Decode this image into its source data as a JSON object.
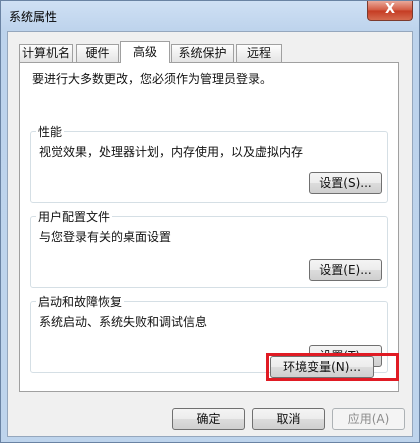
{
  "window": {
    "title": "系统属性",
    "close_label": "X"
  },
  "tabs": [
    {
      "label": "计算机名",
      "active": false
    },
    {
      "label": "硬件",
      "active": false
    },
    {
      "label": "高级",
      "active": true
    },
    {
      "label": "系统保护",
      "active": false
    },
    {
      "label": "远程",
      "active": false
    }
  ],
  "advanced": {
    "admin_note": "要进行大多数更改，您必须作为管理员登录。",
    "performance": {
      "title": "性能",
      "description": "视觉效果，处理器计划，内存使用，以及虚拟内存",
      "button": "设置(S)..."
    },
    "user_profiles": {
      "title": "用户配置文件",
      "description": "与您登录有关的桌面设置",
      "button": "设置(E)..."
    },
    "startup_recovery": {
      "title": "启动和故障恢复",
      "description": "系统启动、系统失败和调试信息",
      "button": "设置(T)..."
    },
    "env_button": "环境变量(N)..."
  },
  "footer": {
    "ok": "确定",
    "cancel": "取消",
    "apply": "应用(A)"
  }
}
